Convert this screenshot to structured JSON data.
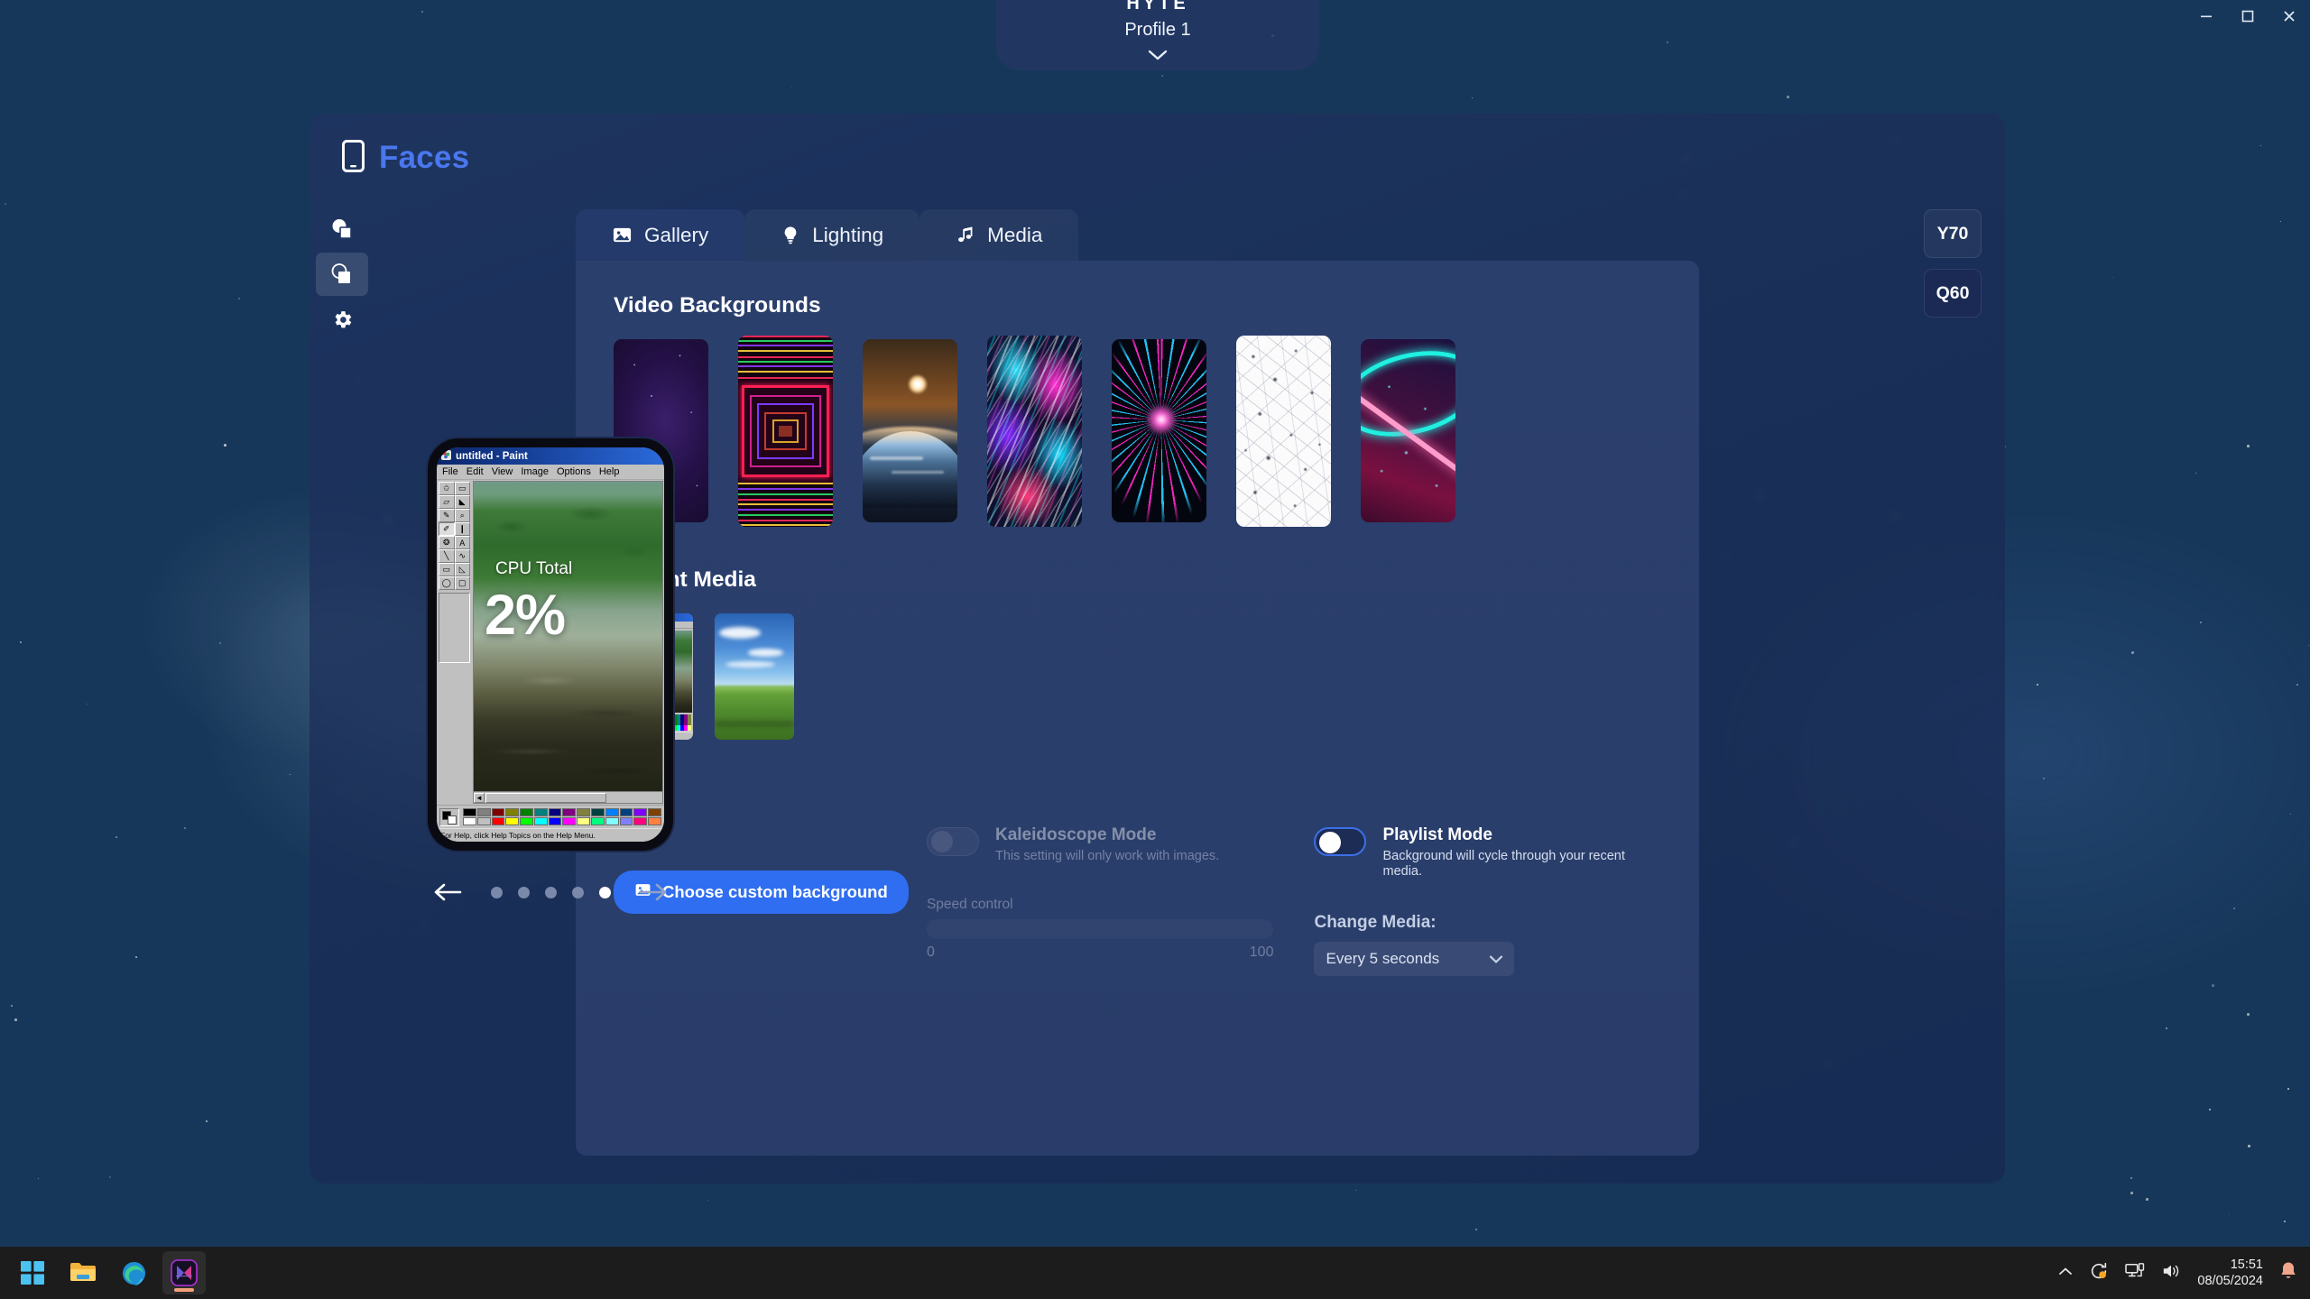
{
  "window": {
    "minimize_label": "Minimize",
    "maximize_label": "Maximize",
    "close_label": "Close"
  },
  "profile": {
    "brand": "HYTE",
    "name": "Profile 1",
    "chevron_icon": "chevron-down-icon"
  },
  "header": {
    "title": "Faces",
    "icon": "device-phone-icon"
  },
  "rail": {
    "items": [
      {
        "name": "shapes-outline-icon",
        "active": false
      },
      {
        "name": "shapes-filled-icon",
        "active": true
      },
      {
        "name": "gear-icon",
        "active": false
      }
    ]
  },
  "tabs": [
    {
      "label": "Gallery",
      "icon": "image-icon",
      "active": true
    },
    {
      "label": "Lighting",
      "icon": "lightbulb-icon",
      "active": false
    },
    {
      "label": "Media",
      "icon": "music-note-icon",
      "active": false
    }
  ],
  "sections": {
    "video_backgrounds_title": "Video Backgrounds",
    "recent_media_title": "Recent Media"
  },
  "video_backgrounds": [
    {
      "name": "purple-nebula-stars"
    },
    {
      "name": "neon-tunnel-squares"
    },
    {
      "name": "earth-sunrise-from-space"
    },
    {
      "name": "iridescent-chrome-liquid"
    },
    {
      "name": "magenta-cyan-warp-burst"
    },
    {
      "name": "white-network-constellation"
    },
    {
      "name": "neon-ring-pink-teal"
    }
  ],
  "recent_media": [
    {
      "name": "ms-paint-screenshot"
    },
    {
      "name": "windows-xp-bliss-wallpaper"
    }
  ],
  "buttons": {
    "choose_custom_background": "Choose custom background",
    "choose_custom_background_icon": "image-icon"
  },
  "kaleidoscope": {
    "title": "Kaleidoscope Mode",
    "subtitle": "This setting will only work with images.",
    "enabled": false,
    "speed_label": "Speed control",
    "speed_min": "0",
    "speed_max": "100",
    "speed_value": 0
  },
  "playlist": {
    "title": "Playlist Mode",
    "subtitle": "Background will cycle through your recent media.",
    "enabled": false,
    "change_media_label": "Change Media:",
    "change_media_value": "Every 5 seconds",
    "change_media_caret": "chevron-down-icon"
  },
  "devices": [
    {
      "label": "Y70",
      "selected": false
    },
    {
      "label": "Q60",
      "selected": true
    }
  ],
  "preview": {
    "paint": {
      "title": "untitled - Paint",
      "menus": [
        "File",
        "Edit",
        "View",
        "Image",
        "Options",
        "Help"
      ],
      "status": "For Help, click Help Topics on the Help Menu.",
      "tools": [
        "free-select",
        "rect-select",
        "eraser",
        "fill",
        "picker",
        "magnifier",
        "pencil",
        "brush",
        "airbrush",
        "text",
        "line",
        "curve",
        "rectangle",
        "polygon",
        "ellipse",
        "rounded-rectangle"
      ]
    },
    "overlay": {
      "metric_label": "CPU Total",
      "metric_value": "2%"
    }
  },
  "carousel": {
    "prev_icon": "arrow-left-icon",
    "next_icon": "arrow-right-icon",
    "dot_count": 5,
    "active_index": 4
  },
  "taskbar": {
    "items": [
      {
        "name": "start-button",
        "label": "Start"
      },
      {
        "name": "file-explorer-button",
        "label": "File Explorer"
      },
      {
        "name": "edge-browser-button",
        "label": "Microsoft Edge"
      },
      {
        "name": "hyte-nexus-button",
        "label": "HYTE NEXUS"
      }
    ],
    "tray": {
      "overflow_icon": "chevron-up-icon",
      "sync_icon": "sync-icon",
      "network_icon": "network-icon",
      "volume_icon": "volume-icon",
      "notification_icon": "bell-icon",
      "time": "15:51",
      "date": "08/05/2024"
    }
  },
  "colors": {
    "accent_blue": "#2f6ef0",
    "title_blue": "#4a77ee",
    "card_bg": "#2b3f6d",
    "tab_active": "#243a6b",
    "panel_bg": "#213462"
  }
}
